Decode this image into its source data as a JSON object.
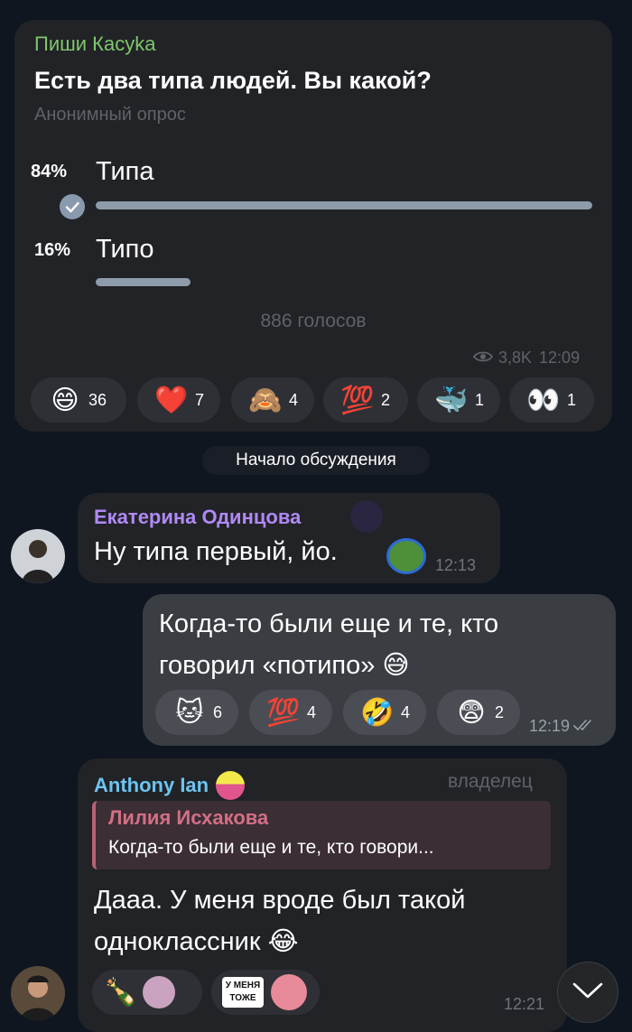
{
  "poll": {
    "channel": "Пиши Касуka",
    "question": "Есть два типа людей. Вы какой?",
    "type_label": "Анонимный опрос",
    "options": [
      {
        "percent_label": "84%",
        "text": "Типа",
        "fraction": 0.84,
        "chosen": true
      },
      {
        "percent_label": "16%",
        "text": "Типо",
        "fraction": 0.16,
        "chosen": false
      }
    ],
    "votes_label": "886 голосов",
    "views": "3,8K",
    "time": "12:09",
    "reactions": [
      {
        "emoji": "😄",
        "count": "36"
      },
      {
        "emoji": "❤️",
        "count": "7"
      },
      {
        "emoji": "🙈",
        "count": "4"
      },
      {
        "emoji": "💯",
        "count": "2"
      },
      {
        "emoji": "🐳",
        "count": "1"
      },
      {
        "emoji": "👀",
        "count": "1"
      }
    ]
  },
  "divider": "Начало обсуждения",
  "msg1": {
    "author": "Екатерина Одинцова",
    "author_color": "#b189f5",
    "text": "Ну типа первый, йо.",
    "time": "12:13"
  },
  "msg2": {
    "line1": "Когда-то были еще и те, кто",
    "line2": "говорил «потипо»",
    "emoji": "😅",
    "time": "12:19",
    "reactions": [
      {
        "emoji": "🐱",
        "count": "6"
      },
      {
        "emoji": "💯",
        "count": "4"
      },
      {
        "emoji": "🤣",
        "count": "4"
      },
      {
        "emoji": "😨",
        "count": "2"
      }
    ]
  },
  "msg3": {
    "author": "Anthony Ian",
    "author_color": "#6cc4f0",
    "badge": "владелец",
    "reply_author": "Лилия Исхакова",
    "reply_text": "Когда-то были еще и те, кто говори...",
    "line1": "Дааа. У меня вроде был такой",
    "line2": "одноклассник",
    "emoji": "😂",
    "time": "12:21",
    "sticker_text": "У МЕНЯ ТОЖЕ",
    "bottle_emoji": "🍾"
  }
}
